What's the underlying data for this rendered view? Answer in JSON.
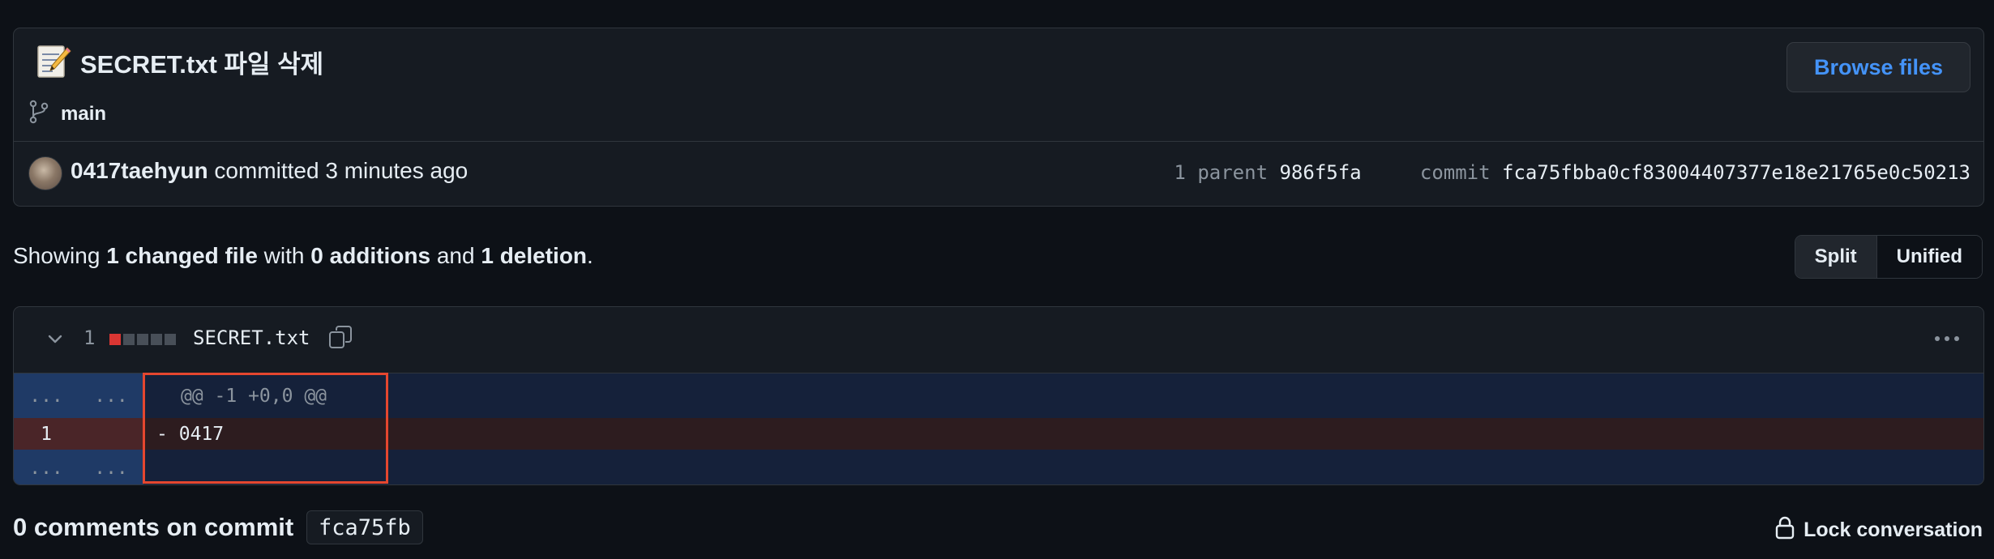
{
  "commit": {
    "emoji": "📝",
    "title": "SECRET.txt 파일 삭제",
    "branch": "main",
    "browse_label": "Browse files",
    "author": "0417taehyun",
    "action": "committed 3 minutes ago",
    "parent_label": "1 parent",
    "parent_sha": "986f5fa",
    "commit_label": "commit",
    "commit_sha": "fca75fbba0cf83004407377e18e21765e0c50213"
  },
  "summary": {
    "showing": "Showing ",
    "changed": "1 changed file",
    "with": " with ",
    "additions": "0 additions",
    "and": " and ",
    "deletions": "1 deletion",
    "period": "."
  },
  "view_options": {
    "split": "Split",
    "unified": "Unified",
    "selected": "Split"
  },
  "file": {
    "change_count": "1",
    "name": "SECRET.txt",
    "diffstat": {
      "deleted_blocks": 1,
      "neutral_blocks": 4,
      "deleted_color": "#da3633",
      "neutral_color": "#484f58"
    },
    "hunk_header": "@@ -1 +0,0 @@",
    "expand_left": "...",
    "expand_right": "...",
    "lines": [
      {
        "old": "1",
        "new": "",
        "sign": "-",
        "text": "0417",
        "type": "deletion"
      }
    ]
  },
  "comments": {
    "title": "0 comments on commit",
    "short_sha": "fca75fb",
    "lock_label": "Lock conversation"
  },
  "colors": {
    "accent_link": "#4493f8",
    "highlight": "#e5472f",
    "deletion_bg": "#2d1c1f",
    "hunk_bg": "#15213a"
  }
}
